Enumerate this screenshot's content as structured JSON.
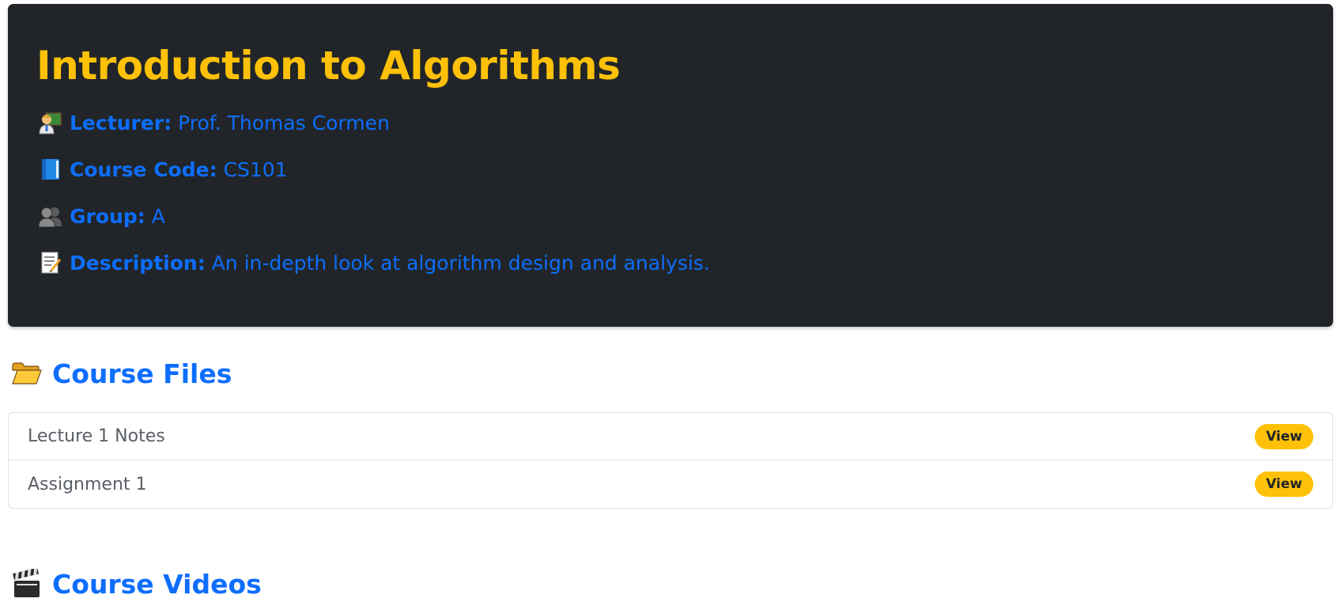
{
  "course": {
    "title": "Introduction to Algorithms",
    "lecturer_label": "Lecturer:",
    "lecturer_value": "Prof. Thomas Cormen",
    "code_label": "Course Code:",
    "code_value": "CS101",
    "group_label": "Group:",
    "group_value": "A",
    "description_label": "Description:",
    "description_value": "An in-depth look at algorithm design and analysis."
  },
  "files_section": {
    "title": "Course Files",
    "icon": "open-folder-icon",
    "files": [
      {
        "name": "Lecture 1 Notes",
        "action": "View"
      },
      {
        "name": "Assignment 1",
        "action": "View"
      }
    ]
  },
  "videos_section": {
    "title": "Course Videos",
    "icon": "clapper-board-icon"
  },
  "colors": {
    "card_background": "#212529",
    "title_yellow": "#ffc107",
    "accent_blue": "#0d6efd",
    "button_yellow": "#ffc107"
  }
}
